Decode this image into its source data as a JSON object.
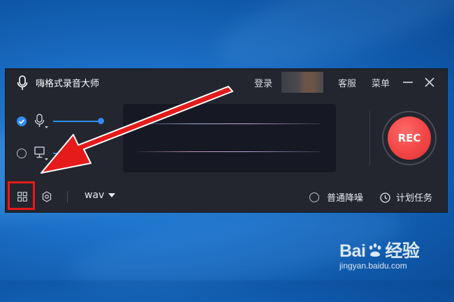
{
  "window": {
    "title": "嗨格式录音大师",
    "login_label": "登录",
    "service_label": "客服",
    "menu_label": "菜单"
  },
  "sources": [
    {
      "name": "microphone",
      "selected": true,
      "volume": 0.95
    },
    {
      "name": "system-audio",
      "selected": false
    }
  ],
  "record_button": {
    "label": "REC"
  },
  "bottom_bar": {
    "format_value": "wav",
    "denoise_label": "普通降噪",
    "schedule_label": "计划任务"
  },
  "icons": {
    "title": "microphone-icon",
    "minimize": "minimize-icon",
    "close": "close-icon",
    "grid": "grid-icon",
    "settings": "gear-icon",
    "clock": "clock-icon"
  },
  "colors": {
    "accent": "#2f8cf2",
    "record": "#f24545",
    "annotation": "#e51b1b"
  },
  "watermark": {
    "brand_a": "Bai",
    "brand_b": "经验",
    "url": "jingyan.baidu.com"
  }
}
